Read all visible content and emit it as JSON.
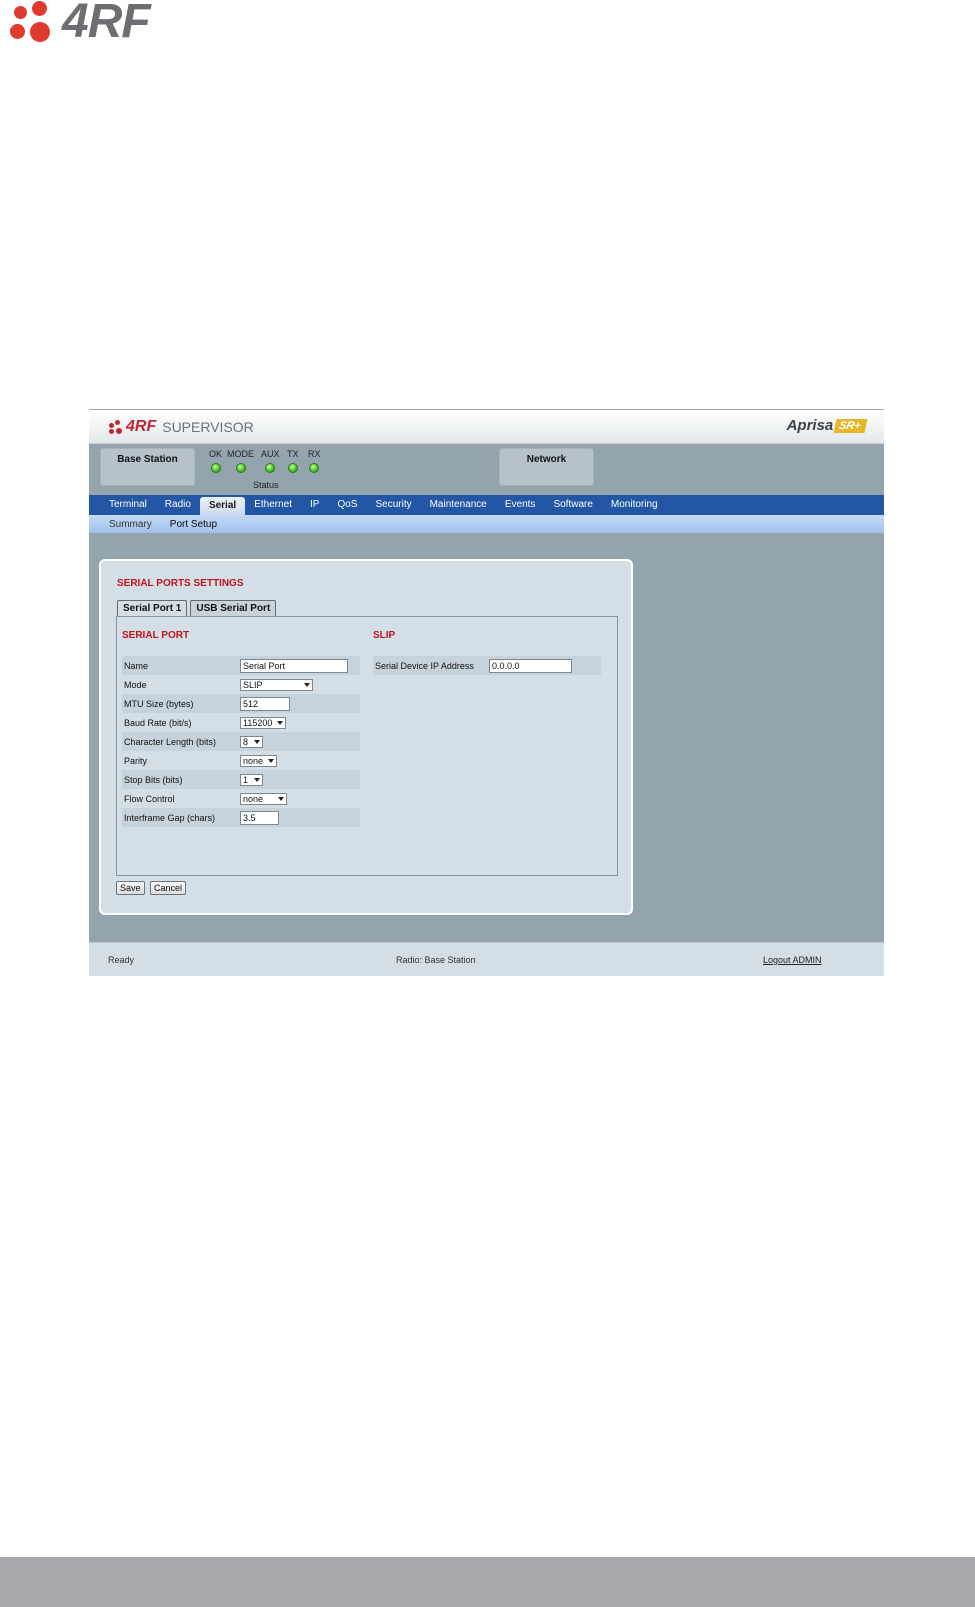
{
  "page": {
    "logo_text": "4RF"
  },
  "app": {
    "header": {
      "brand": "4RF",
      "product": "SUPERVISOR",
      "aprisa_name": "Aprisa",
      "aprisa_badge": "SR+"
    },
    "status": {
      "base_station_label": "Base Station",
      "network_label": "Network",
      "leds": [
        {
          "label": "OK",
          "color": "#40c020"
        },
        {
          "label": "MODE",
          "color": "#40c020"
        },
        {
          "label": "AUX",
          "color": "#40c020"
        },
        {
          "label": "TX",
          "color": "#40c020"
        },
        {
          "label": "RX",
          "color": "#40c020"
        }
      ],
      "caption": "Status"
    },
    "nav": {
      "items": [
        "Terminal",
        "Radio",
        "Serial",
        "Ethernet",
        "IP",
        "QoS",
        "Security",
        "Maintenance",
        "Events",
        "Software",
        "Monitoring"
      ],
      "active": "Serial"
    },
    "subnav": {
      "items": [
        "Summary",
        "Port Setup"
      ],
      "active": "Port Setup"
    },
    "settings": {
      "title": "SERIAL PORTS SETTINGS",
      "tabs": [
        "Serial Port 1",
        "USB Serial Port"
      ],
      "active_tab": "Serial Port 1",
      "serial_port": {
        "heading": "SERIAL PORT",
        "name_label": "Name",
        "name_value": "Serial Port",
        "mode_label": "Mode",
        "mode_value": "SLIP",
        "mtu_label": "MTU Size (bytes)",
        "mtu_value": "512",
        "baud_label": "Baud Rate (bit/s)",
        "baud_value": "115200",
        "charlen_label": "Character Length (bits)",
        "charlen_value": "8",
        "parity_label": "Parity",
        "parity_value": "none",
        "stopbits_label": "Stop Bits (bits)",
        "stopbits_value": "1",
        "flow_label": "Flow Control",
        "flow_value": "none",
        "gap_label": "Interframe Gap (chars)",
        "gap_value": "3.5"
      },
      "slip": {
        "heading": "SLIP",
        "ip_label": "Serial Device IP Address",
        "ip_value": "0.0.0.0"
      },
      "save_label": "Save",
      "cancel_label": "Cancel"
    },
    "footer": {
      "ready": "Ready",
      "radio": "Radio: Base Station",
      "logout": "Logout ADMIN"
    }
  },
  "colors": {
    "nav_bg": "#2456a6",
    "section_red": "#c0141c",
    "logo_red": "#e03a2f",
    "panel_bg": "#d3dee7",
    "frame_bg": "#94a4ae"
  }
}
